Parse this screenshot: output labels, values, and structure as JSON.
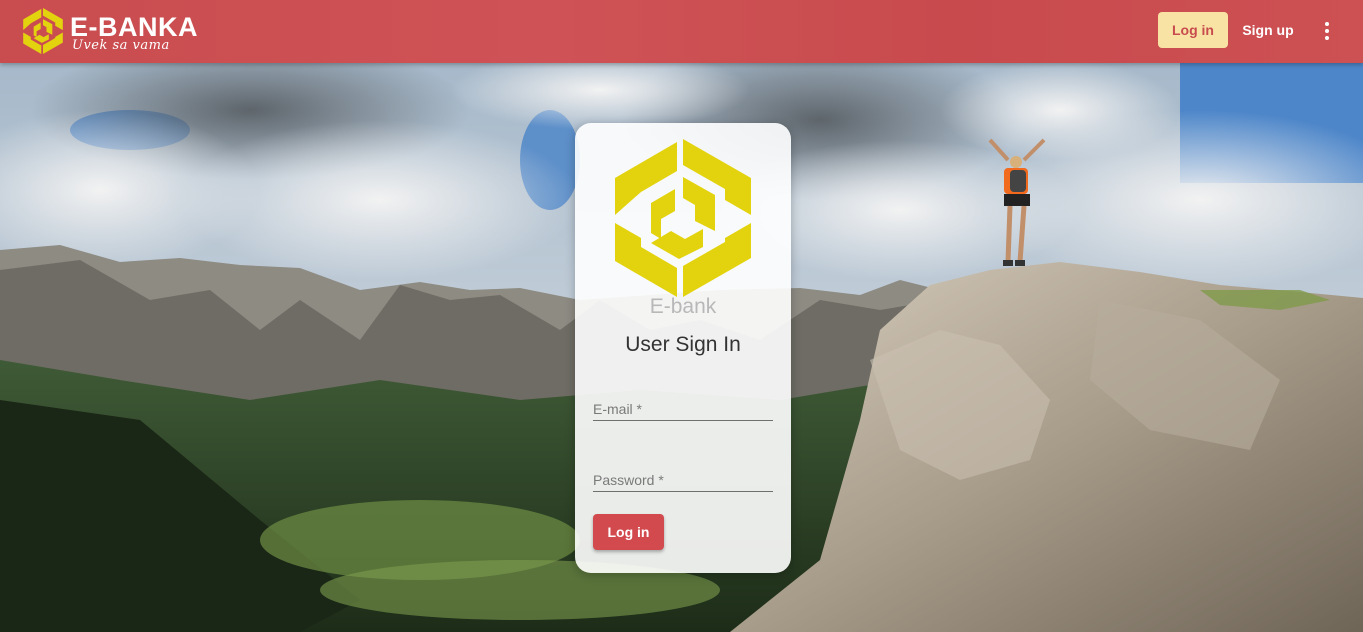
{
  "header": {
    "brand_name": "E-BANKA",
    "brand_tagline": "Uvek sa vama",
    "login_label": "Log in",
    "signup_label": "Sign up",
    "more_icon": "more-vert-icon"
  },
  "login_card": {
    "logo_icon": "ebank-hexagon-logo-icon",
    "brand": "E-bank",
    "title": "User Sign In",
    "email_placeholder": "E-mail *",
    "email_value": "",
    "password_placeholder": "Password *",
    "password_value": "",
    "submit_label": "Log in"
  },
  "colors": {
    "header_bg": "#c94c4f",
    "nav_login_bg": "#f8e3a5",
    "submit_bg": "#d24a4e",
    "logo_yellow": "#e3d30f"
  }
}
